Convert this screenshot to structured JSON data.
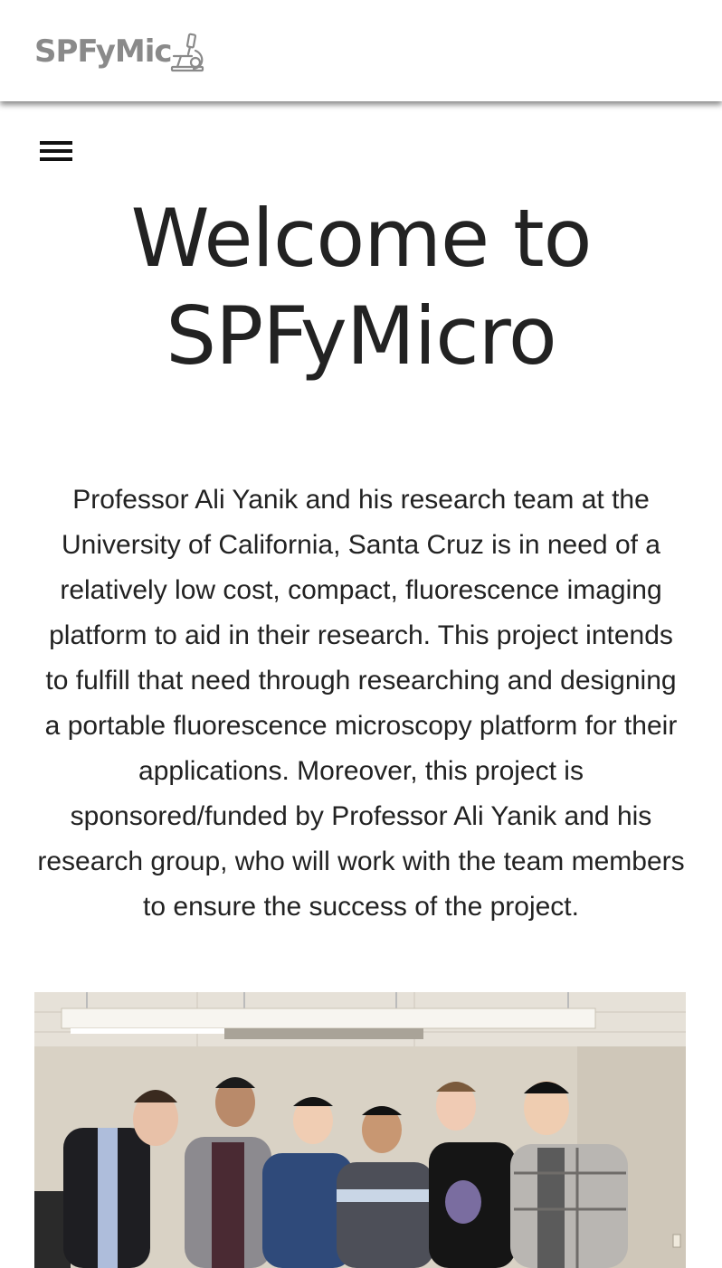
{
  "header": {
    "logo_text": "SPFyMic",
    "logo_icon": "microscope-icon"
  },
  "nav": {
    "menu_icon": "hamburger-menu-icon"
  },
  "main": {
    "title_line1": "Welcome to",
    "title_line2": "SPFyMicro",
    "intro": "Professor Ali Yanik and his research team at the University of California, Santa Cruz is in need of a relatively low cost, compact, fluorescence imaging platform to aid in their research. This project intends to fulfill that need through researching and designing a portable fluorescence microscopy platform for their applications. Moreover, this project is sponsored/funded by Professor Ali Yanik and his research group, who will work with the team members to ensure the success of the project."
  },
  "colors": {
    "logo": "#8a8a8a",
    "text": "#222222",
    "background": "#ffffff"
  }
}
